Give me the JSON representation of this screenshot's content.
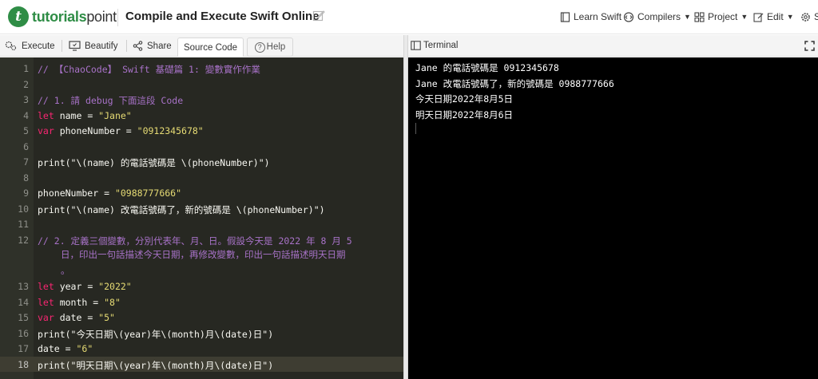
{
  "header": {
    "logo_part1": "tutorials",
    "logo_part2": "point",
    "logo_mark": "t",
    "page_title": "Compile and Execute Swift Online",
    "nav": [
      {
        "label": "Learn Swift",
        "icon": "book-icon"
      },
      {
        "label": "Compilers",
        "icon": "code-icon"
      },
      {
        "label": "Project",
        "icon": "grid-icon"
      },
      {
        "label": "Edit",
        "icon": "edit-icon"
      },
      {
        "label": "S",
        "icon": "settings-icon"
      }
    ]
  },
  "toolbar": {
    "execute": "Execute",
    "beautify": "Beautify",
    "share": "Share",
    "source_code": "Source Code",
    "help": "Help",
    "help_glyph": "?",
    "terminal": "Terminal"
  },
  "editor": {
    "lines": [
      {
        "n": "1",
        "text": "// 【ChaoCode】 Swift 基礎篇 1: 變數實作作業"
      },
      {
        "n": "2",
        "text": ""
      },
      {
        "n": "3",
        "text": "// 1. 請 debug 下面這段 Code"
      },
      {
        "n": "4",
        "kw": "let",
        "rest": " name = ",
        "str": "\"Jane\""
      },
      {
        "n": "5",
        "kw": "var",
        "rest": " phoneNumber = ",
        "str": "\"0912345678\""
      },
      {
        "n": "6",
        "text": ""
      },
      {
        "n": "7",
        "text": "print(\"\\(name) 的電話號碼是 \\(phoneNumber)\")"
      },
      {
        "n": "8",
        "text": ""
      },
      {
        "n": "9",
        "rest": "phoneNumber = ",
        "str": "\"0988777666\""
      },
      {
        "n": "10",
        "text": "print(\"\\(name) 改電話號碼了，新的號碼是 \\(phoneNumber)\")"
      },
      {
        "n": "11",
        "text": ""
      },
      {
        "n": "12",
        "text": "// 2. 定義三個變數，分別代表年、月、日。假設今天是 2022 年 8 月 5",
        "wrap1": "日，印出一句話描述今天日期，再修改變數，印出一句話描述明天日期",
        "wrap2": "。"
      },
      {
        "n": "13",
        "kw": "let",
        "rest": " year = ",
        "str": "\"2022\""
      },
      {
        "n": "14",
        "kw": "let",
        "rest": " month = ",
        "str": "\"8\""
      },
      {
        "n": "15",
        "kw": "var",
        "rest": " date = ",
        "str": "\"5\""
      },
      {
        "n": "16",
        "text": "print(\"今天日期\\(year)年\\(month)月\\(date)日\")"
      },
      {
        "n": "17",
        "rest": "date = ",
        "str": "\"6\""
      },
      {
        "n": "18",
        "text": "print(\"明天日期\\(year)年\\(month)月\\(date)日\")"
      }
    ]
  },
  "terminal": {
    "output": [
      "Jane 的電話號碼是 0912345678",
      "Jane 改電話號碼了，新的號碼是 0988777666",
      "今天日期2022年8月5日",
      "明天日期2022年8月6日"
    ]
  },
  "colors": {
    "brand": "#2f8d46",
    "editor_bg": "#272822",
    "terminal_bg": "#000000",
    "comment": "#a872c8",
    "keyword": "#f92672",
    "string": "#e6db74"
  }
}
